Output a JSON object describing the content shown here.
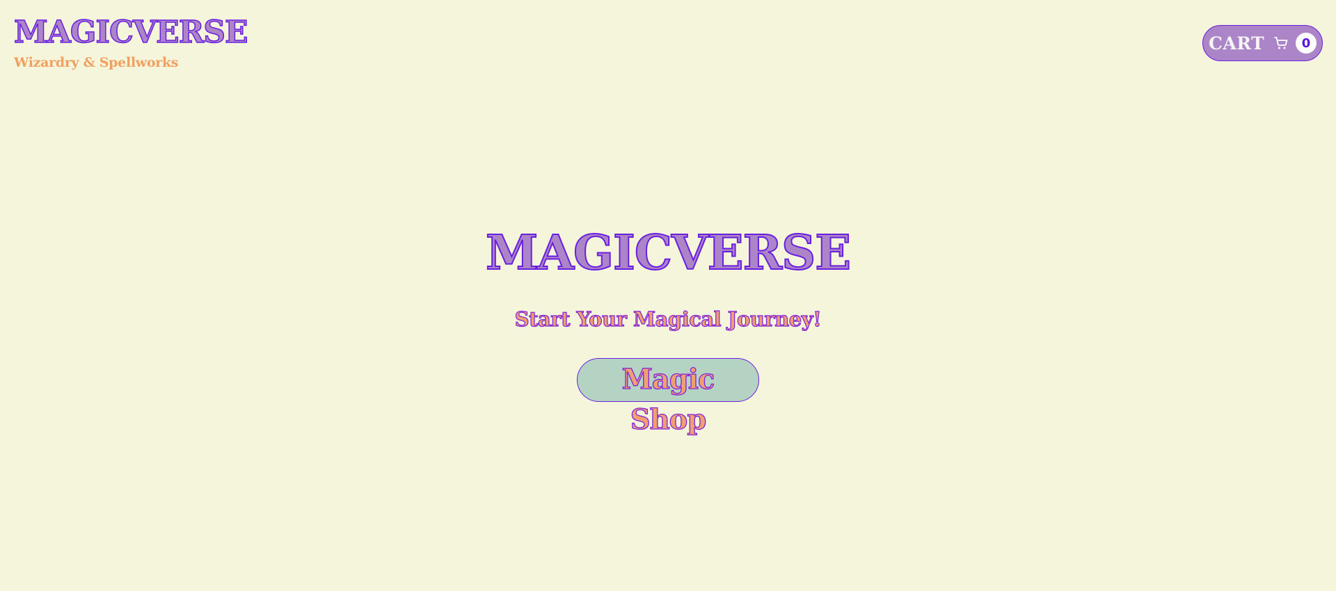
{
  "header": {
    "brand_title": "MAGICVERSE",
    "brand_tagline": "Wizardry & Spellworks"
  },
  "cart": {
    "label": "CART",
    "icon": "shopping-cart-icon",
    "count": "0"
  },
  "hero": {
    "title": "MAGICVERSE",
    "subtitle": "Start Your Magical Journey!",
    "button_label": "Magic Shop"
  },
  "colors": {
    "background": "#f5f5dc",
    "purple": "#ac84c8",
    "purple_outline": "#6a1ee0",
    "orange": "#f0a070",
    "button_bg": "#b5d3c2"
  }
}
